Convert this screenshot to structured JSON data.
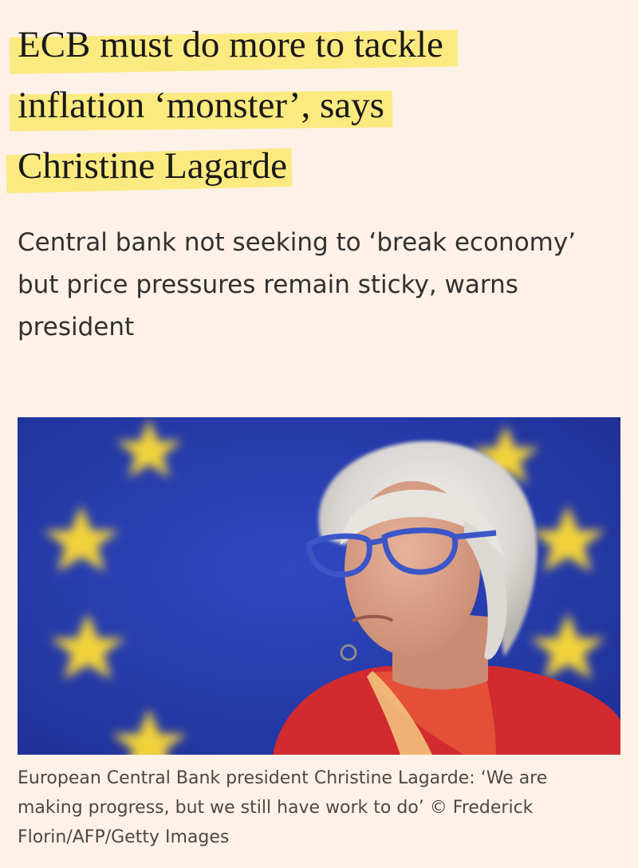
{
  "article": {
    "headline_lines": [
      "ECB must do more to tackle",
      "inflation ‘monster’, says",
      "Christine Lagarde"
    ],
    "standfirst_lines": [
      "Central bank not seeking to ‘break economy’",
      "but price pressures remain sticky, warns",
      "president"
    ],
    "caption_lines": [
      "European Central Bank president Christine Lagarde: ‘We are",
      "making progress, but we still have work to do’ © Frederick",
      "Florin/AFP/Getty Images"
    ]
  },
  "colors": {
    "page_background": "#fdf1e8",
    "highlight": "#fbe97a",
    "photo_background": "#2a3fb0",
    "star_color": "#f2d23a",
    "jacket": "#d12b2f"
  }
}
